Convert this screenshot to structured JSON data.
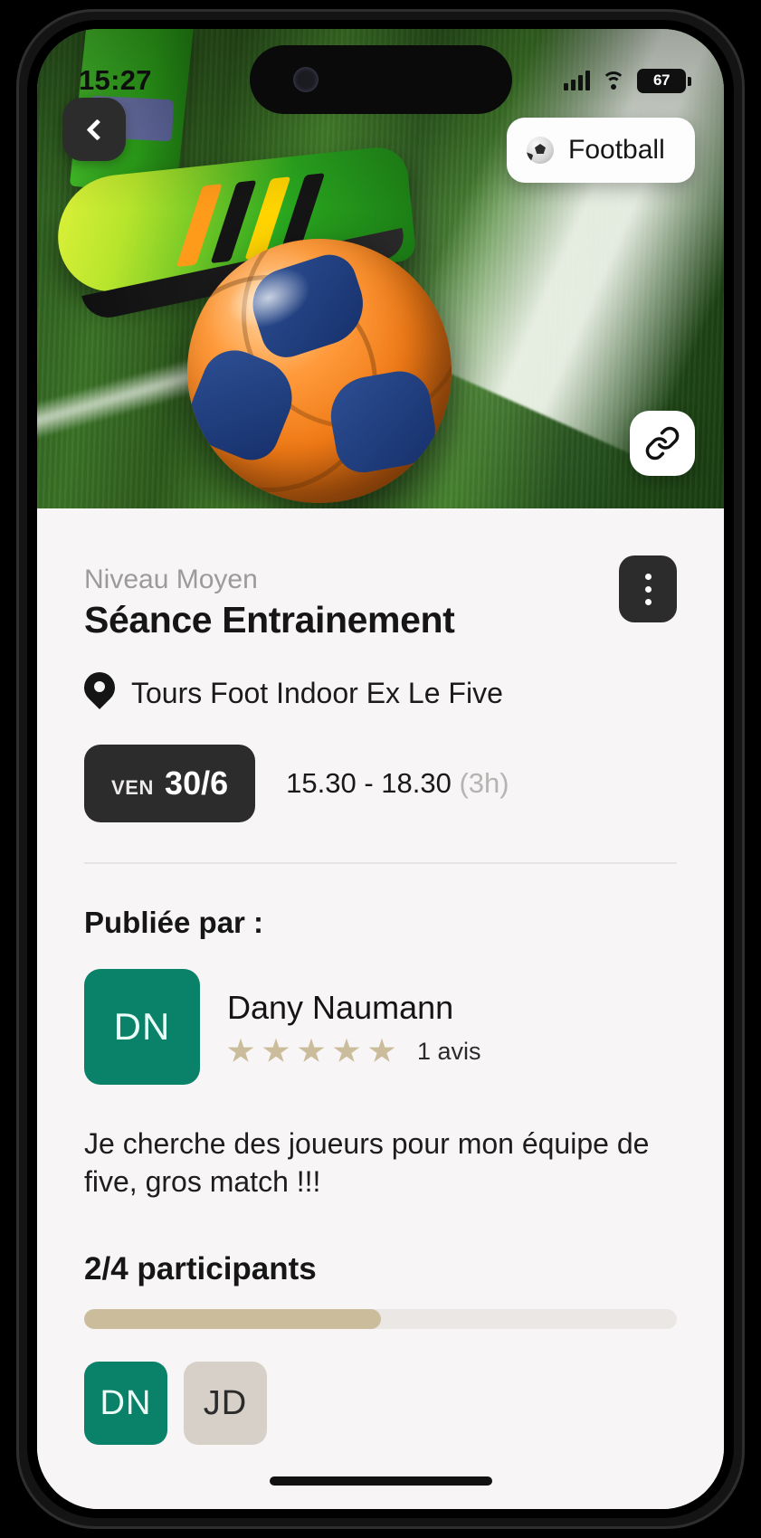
{
  "status_bar": {
    "time": "15:27",
    "battery_level": "67",
    "signal_icon": "cellular-bars-icon",
    "wifi_icon": "wifi-icon"
  },
  "hero": {
    "back_icon": "chevron-left-icon",
    "sport_chip": {
      "label": "Football",
      "icon": "soccer-ball-icon"
    },
    "link_icon": "link-chain-icon",
    "image_alt": "green football boot resting on an orange and blue ball on grass pitch"
  },
  "event": {
    "level": "Niveau Moyen",
    "title": "Séance Entrainement",
    "menu_icon": "kebab-menu-icon",
    "venue": {
      "icon": "location-pin-icon",
      "name": "Tours Foot Indoor Ex Le Five"
    },
    "date": {
      "weekday": "VEN",
      "day_month": "30/6"
    },
    "time_range": "15.30  -  18.30",
    "duration": "(3h)"
  },
  "publisher": {
    "section_title": "Publiée par :",
    "avatar_initials": "DN",
    "avatar_color": "#0a8269",
    "name": "Dany Naumann",
    "stars_filled": 5,
    "star_color": "#cbbd9b",
    "reviews_label": "1 avis"
  },
  "description": "Je cherche des joueurs pour mon équipe de five, gros match !!!",
  "participants": {
    "heading": "2/4 participants",
    "current": 2,
    "total": 4,
    "progress_percent": 50,
    "progress_color": "#cbbd9b",
    "avatars": [
      {
        "initials": "DN",
        "color": "#0a8269"
      },
      {
        "initials": "JD",
        "color": "#d7d0c8"
      }
    ]
  }
}
